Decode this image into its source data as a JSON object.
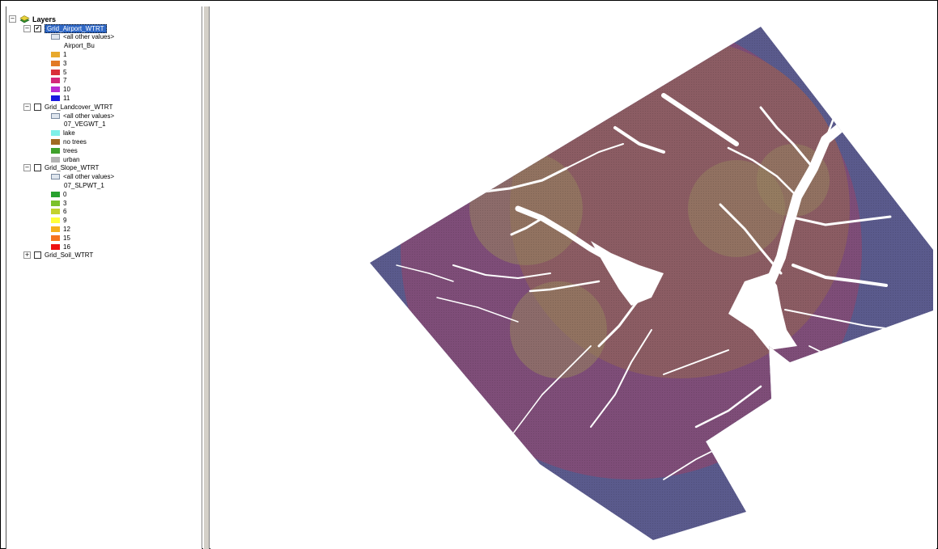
{
  "toc": {
    "root_label": "Layers",
    "layers": [
      {
        "name": "Grid_Airport_WTRT",
        "checked": true,
        "expanded": true,
        "other_values": "<all other values>",
        "field": "Airport_Bu",
        "classes": [
          {
            "label": "1",
            "color": "#e8a92c"
          },
          {
            "label": "3",
            "color": "#e27a25"
          },
          {
            "label": "5",
            "color": "#d9303a"
          },
          {
            "label": "7",
            "color": "#d4287a"
          },
          {
            "label": "10",
            "color": "#b92bd2"
          },
          {
            "label": "11",
            "color": "#1a18e0"
          }
        ]
      },
      {
        "name": "Grid_Landcover_WTRT",
        "checked": false,
        "expanded": true,
        "other_values": "<all other values>",
        "field": "07_VEGWT_1",
        "classes": [
          {
            "label": "lake",
            "color": "#7ff0e8"
          },
          {
            "label": "no trees",
            "color": "#a06a22"
          },
          {
            "label": "trees",
            "color": "#3fa12b"
          },
          {
            "label": "urban",
            "color": "#b3b3b3"
          }
        ]
      },
      {
        "name": "Grid_Slope_WTRT",
        "checked": false,
        "expanded": true,
        "other_values": "<all other values>",
        "field": "07_SLPWT_1",
        "classes": [
          {
            "label": "0",
            "color": "#27a12e"
          },
          {
            "label": "3",
            "color": "#7bc12a"
          },
          {
            "label": "6",
            "color": "#c2d22d"
          },
          {
            "label": "9",
            "color": "#ffff3a"
          },
          {
            "label": "12",
            "color": "#f5b01d"
          },
          {
            "label": "15",
            "color": "#f5731f"
          },
          {
            "label": "16",
            "color": "#ee1111"
          }
        ]
      },
      {
        "name": "Grid_Soil_WTRT",
        "checked": false,
        "expanded": false
      }
    ]
  },
  "map": {
    "colors": {
      "outer_band": "#5a5a8c",
      "middle_band": "#7e4d78",
      "inner_zone": "#8b5c63",
      "core_zone": "#97855f",
      "water": "#ffffff"
    }
  }
}
